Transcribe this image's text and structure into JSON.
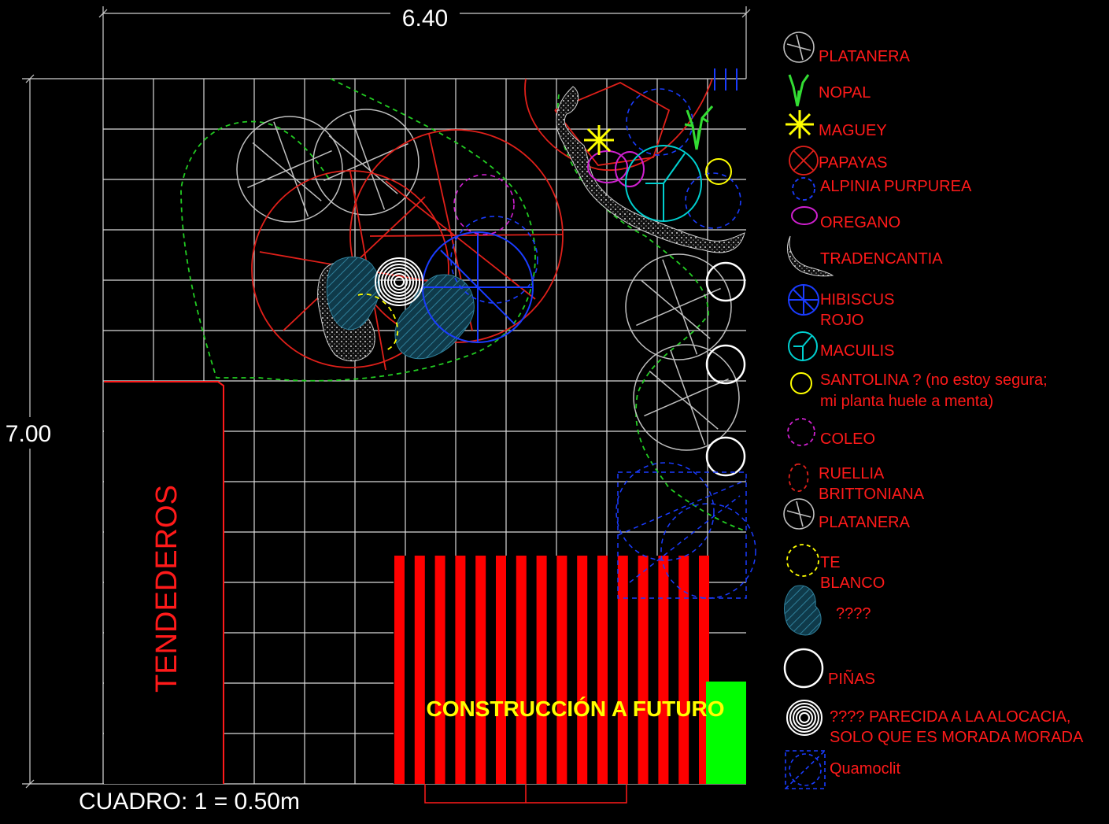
{
  "dimensions": {
    "width": "6.40",
    "height": "7.00"
  },
  "scale_note": "CUADRO: 1 = 0.50m",
  "areas": {
    "tendederos": "TENDEDEROS",
    "construccion": "CONSTRUCCIÓN A FUTURO"
  },
  "colors": {
    "background": "#000000",
    "grid": "#d9d9d9",
    "label_red": "#ff1a1a",
    "construction_red": "#ff0000",
    "construction_green": "#00ff00",
    "construction_text": "#ffff00"
  },
  "legend": [
    {
      "icon": "platanera-icon",
      "label": "PLATANERA"
    },
    {
      "icon": "nopal-icon",
      "label": "NOPAL"
    },
    {
      "icon": "maguey-icon",
      "label": "MAGUEY"
    },
    {
      "icon": "papayas-icon",
      "label": "PAPAYAS"
    },
    {
      "icon": "alpinia-icon",
      "label": "ALPINIA PURPUREA"
    },
    {
      "icon": "oregano-icon",
      "label": "OREGANO"
    },
    {
      "icon": "tradencantia-icon",
      "label": "TRADENCANTIA"
    },
    {
      "icon": "hibiscus-icon",
      "label": "HIBISCUS",
      "label2": "ROJO"
    },
    {
      "icon": "macuilis-icon",
      "label": "MACUILIS"
    },
    {
      "icon": "santolina-icon",
      "label": "SANTOLINA ? (no estoy segura;",
      "label2": "mi planta huele a menta)"
    },
    {
      "icon": "coleo-icon",
      "label": "COLEO"
    },
    {
      "icon": "ruellia-icon",
      "label": "RUELLIA",
      "label2": "BRITTONIANA"
    },
    {
      "icon": "platanera-icon",
      "label": "PLATANERA"
    },
    {
      "icon": "te-blanco-icon",
      "label": "TE",
      "label2": "BLANCO"
    },
    {
      "icon": "unknown-hatch-icon",
      "label": "????"
    },
    {
      "icon": "pinas-icon",
      "label": "PIÑAS"
    },
    {
      "icon": "alocacia-icon",
      "label": "???? PARECIDA A LA ALOCACIA,",
      "label2": "SOLO QUE ES MORADA MORADA"
    },
    {
      "icon": "quamoclit-icon",
      "label": "Quamoclit"
    }
  ]
}
